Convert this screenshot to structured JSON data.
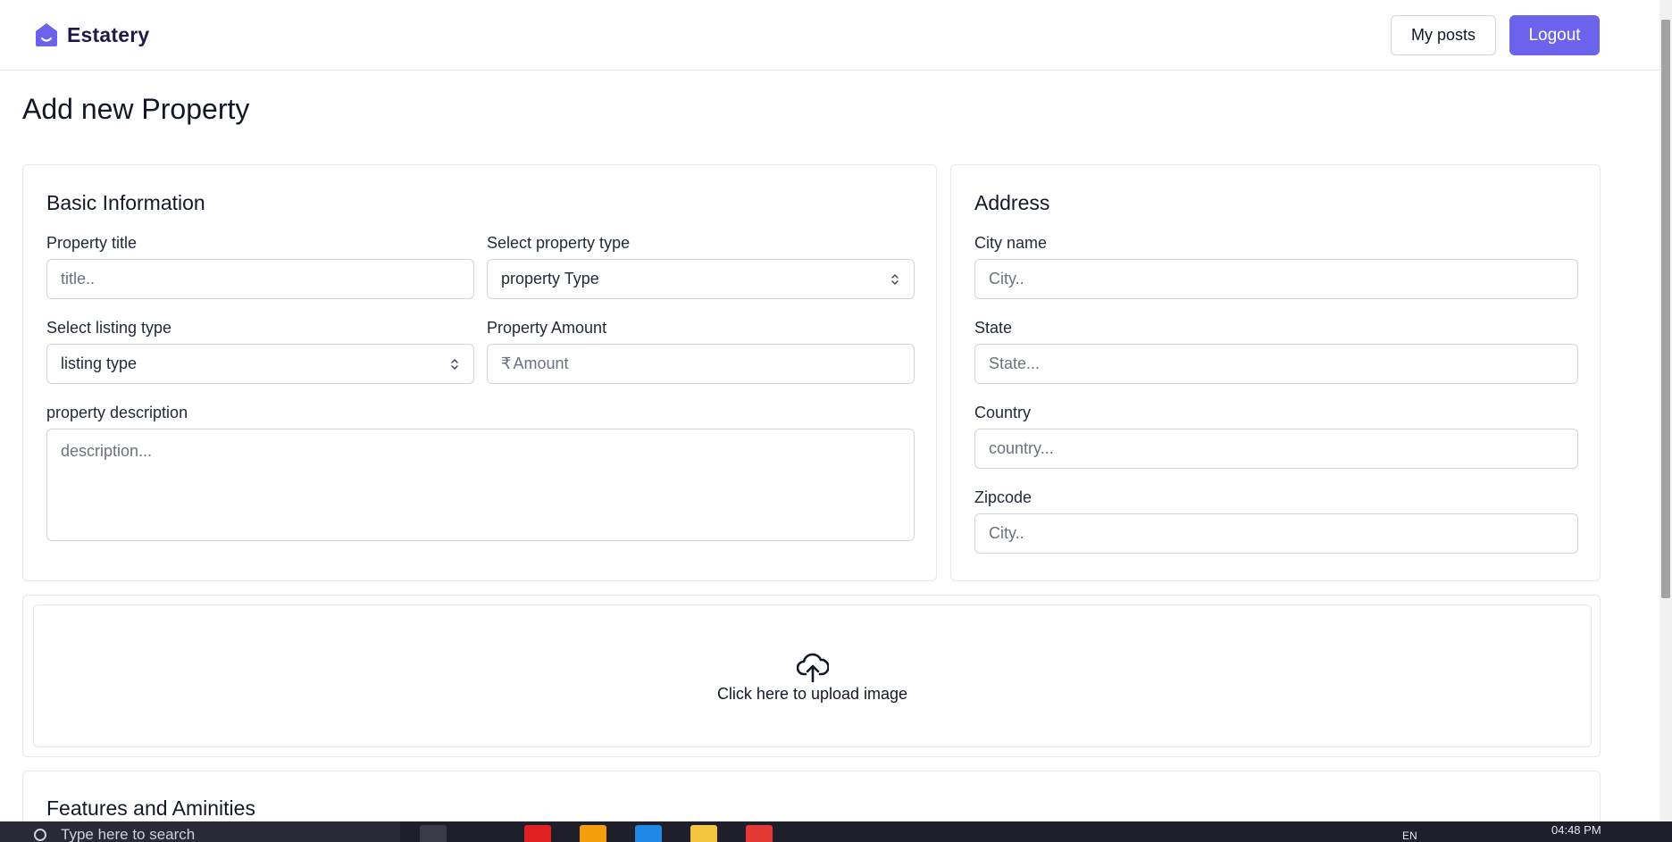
{
  "brand": {
    "name": "Estatery",
    "color": "#6c63ec"
  },
  "header": {
    "my_posts_label": "My posts",
    "logout_label": "Logout"
  },
  "page": {
    "title": "Add new Property"
  },
  "basic_info": {
    "title": "Basic Information",
    "property_title_label": "Property title",
    "property_title_placeholder": "title..",
    "property_type_label": "Select property type",
    "property_type_value": "property Type",
    "listing_type_label": "Select listing type",
    "listing_type_value": "listing type",
    "amount_label": "Property Amount",
    "amount_currency": "₹",
    "amount_placeholder": "Amount",
    "description_label": "property description",
    "description_placeholder": "description..."
  },
  "address": {
    "title": "Address",
    "city_label": "City name",
    "city_placeholder": "City..",
    "state_label": "State",
    "state_placeholder": "State...",
    "country_label": "Country",
    "country_placeholder": "country...",
    "zipcode_label": "Zipcode",
    "zipcode_placeholder": "City.."
  },
  "upload": {
    "icon": "cloud-upload-icon",
    "label": "Click here to upload image"
  },
  "features": {
    "title": "Features and Aminities"
  },
  "taskbar": {
    "search_text": "Type here to search",
    "language": "EN",
    "time": "04:48 PM"
  }
}
